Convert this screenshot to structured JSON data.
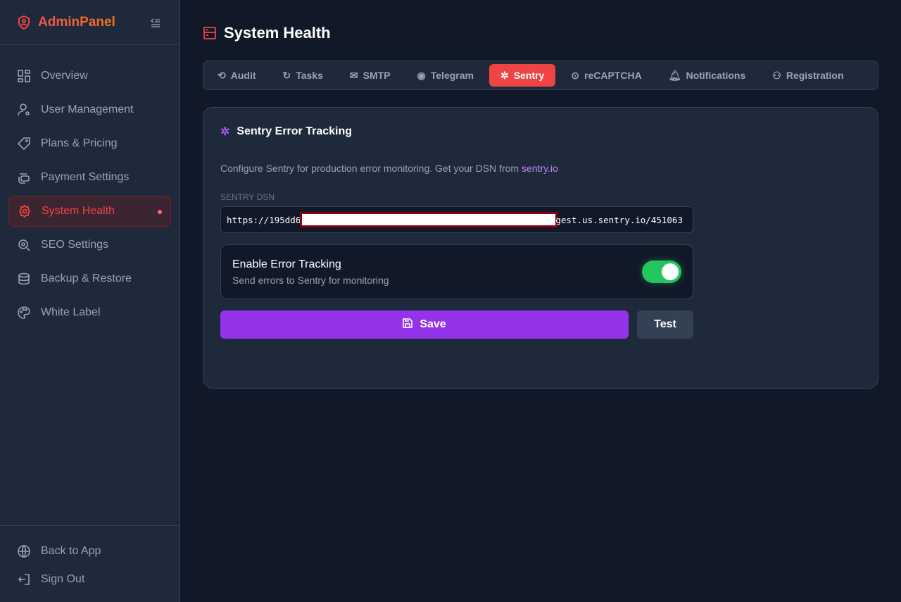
{
  "sidebar": {
    "brand": "AdminPanel",
    "items": [
      {
        "label": "Overview"
      },
      {
        "label": "User Management"
      },
      {
        "label": "Plans & Pricing"
      },
      {
        "label": "Payment Settings"
      },
      {
        "label": "System Health"
      },
      {
        "label": "SEO Settings"
      },
      {
        "label": "Backup & Restore"
      },
      {
        "label": "White Label"
      }
    ],
    "bottom": [
      {
        "label": "Back to App"
      },
      {
        "label": "Sign Out"
      }
    ]
  },
  "header": {
    "title": "System Health"
  },
  "tabs": [
    {
      "label": "Audit"
    },
    {
      "label": "Tasks"
    },
    {
      "label": "SMTP"
    },
    {
      "label": "Telegram"
    },
    {
      "label": "Sentry"
    },
    {
      "label": "reCAPTCHA"
    },
    {
      "label": "Notifications"
    },
    {
      "label": "Registration"
    }
  ],
  "card": {
    "title": "Sentry Error Tracking",
    "description": "Configure Sentry for production error monitoring. Get your DSN from ",
    "link": "sentry.io",
    "dsn_label": "SENTRY DSN",
    "dsn_prefix": "https://195dd6",
    "dsn_suffix": "gest.us.sentry.io/451063",
    "toggle": {
      "title": "Enable Error Tracking",
      "subtitle": "Send errors to Sentry for monitoring",
      "enabled": true
    },
    "save_label": "Save",
    "test_label": "Test"
  },
  "colors": {
    "accent": "#ef4444",
    "purple": "#9333ea",
    "green": "#22c55e"
  }
}
